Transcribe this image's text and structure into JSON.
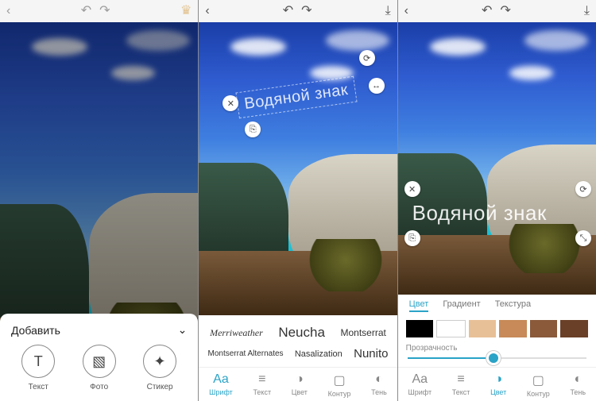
{
  "screen1": {
    "sheet_title": "Добавить",
    "add": [
      {
        "label": "Текст",
        "icon": "T"
      },
      {
        "label": "Фото",
        "icon": "▧"
      },
      {
        "label": "Стикер",
        "icon": "✦"
      }
    ]
  },
  "screen2": {
    "watermark": "Водяной знак",
    "fonts_row1": [
      "Merriweather",
      "Neucha",
      "Montserrat"
    ],
    "fonts_row2": [
      "Montserrat Alternates",
      "Nasalization",
      "Nunito"
    ]
  },
  "screen3": {
    "watermark": "Водяной знак",
    "color_tabs": [
      "Цвет",
      "Градиент",
      "Текстура"
    ],
    "opacity_label": "Прозрачность",
    "swatches": [
      "#000000",
      "#ffffff",
      "#e8c097",
      "#c78a58",
      "#8a5a3a",
      "#6b4028"
    ]
  },
  "tabs": [
    {
      "label": "Шрифт",
      "icon": "Aa"
    },
    {
      "label": "Текст",
      "icon": "≡"
    },
    {
      "label": "Цвет",
      "icon": "◑"
    },
    {
      "label": "Контур",
      "icon": "▢"
    },
    {
      "label": "Тень",
      "icon": "◐"
    }
  ]
}
